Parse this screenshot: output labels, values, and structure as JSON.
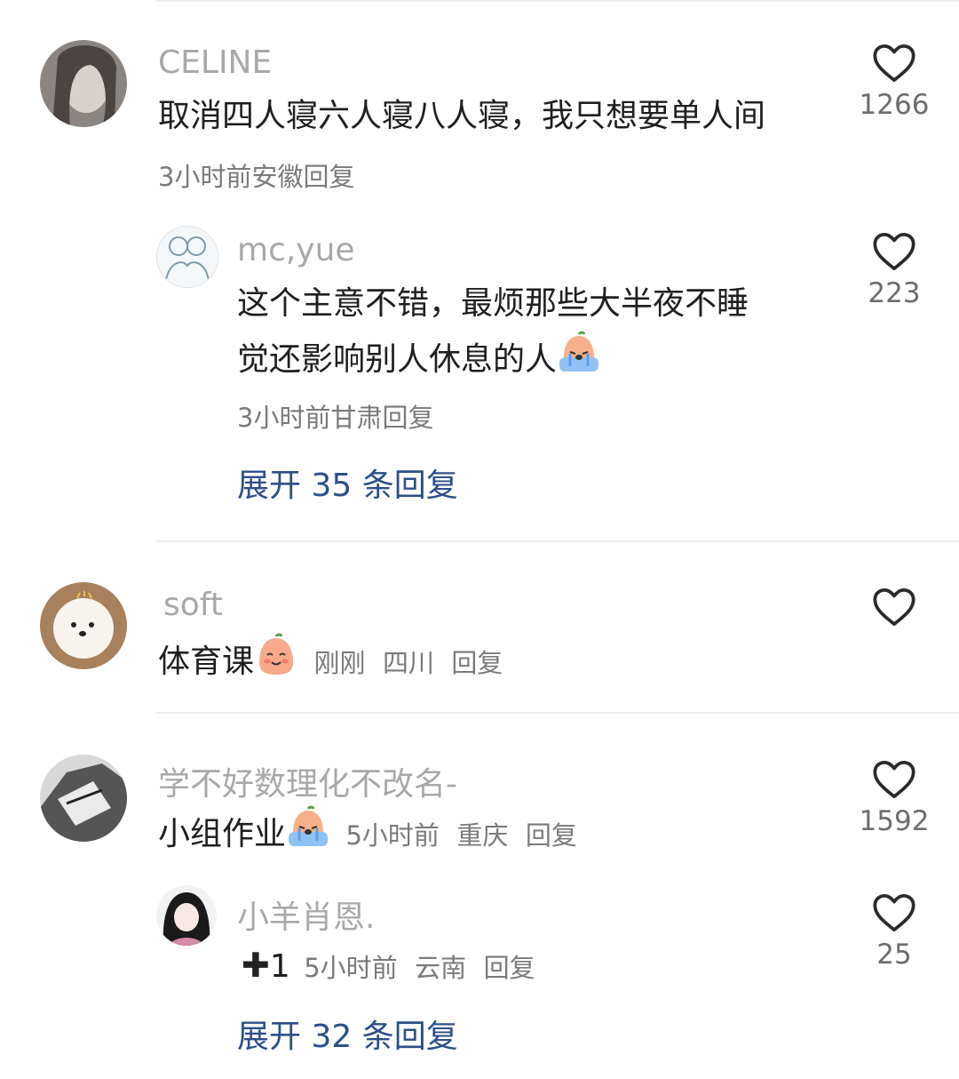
{
  "comments": [
    {
      "user": "CELINE",
      "text": "取消四人寝六人寝八人寝，我只想要单人间",
      "time": "3小时前",
      "location": "安徽",
      "reply": "回复",
      "likes": "1266",
      "replies": [
        {
          "user": "mc,yue",
          "text_line1": "这个主意不错，最烦那些大半夜不睡",
          "text_line2": "觉还影响别人休息的人",
          "emoji": "crying-face-icon",
          "time": "3小时前",
          "location": "甘肃",
          "reply": "回复",
          "likes": "223"
        }
      ],
      "expand_label": "展开 35 条回复"
    },
    {
      "user": "soft",
      "text": "体育课",
      "emoji": "smiling-face-icon",
      "time": "刚刚",
      "location": "四川",
      "reply": "回复",
      "likes": ""
    },
    {
      "user": "学不好数理化不改名-",
      "text": "小组作业",
      "emoji": "crying-face-icon",
      "time": "5小时前",
      "location": "重庆",
      "reply": "回复",
      "likes": "1592",
      "replies": [
        {
          "user": "小羊肖恩.",
          "text": "1",
          "emoji": "plus-icon",
          "time": "5小时前",
          "location": "云南",
          "reply": "回复",
          "likes": "25"
        }
      ],
      "expand_label": "展开 32 条回复"
    }
  ],
  "colors": {
    "username": "#a8a8a8",
    "expand": "#2c4f8a",
    "meta": "#7a7a7a"
  }
}
